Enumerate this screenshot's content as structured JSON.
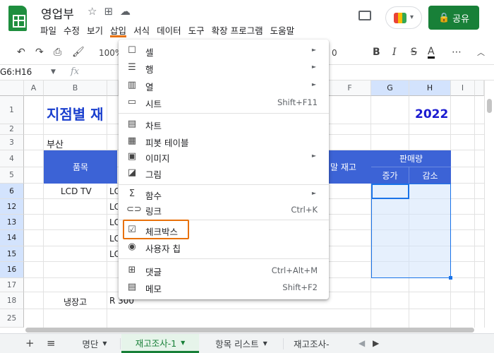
{
  "app": {
    "doc_title": "영업부",
    "share_label": "공유",
    "menus": [
      "파일",
      "수정",
      "보기",
      "삽입",
      "서식",
      "데이터",
      "도구",
      "확장 프로그램",
      "도움말"
    ],
    "active_menu": "삽입",
    "accent_color": "#188038",
    "highlight_color": "#e8710a"
  },
  "toolbar": {
    "zoom": "100%",
    "font_size_partial": "0",
    "bold": "B",
    "italic": "I",
    "strike": "S",
    "text_color": "A",
    "more": "⋯"
  },
  "formula_bar": {
    "name_box": "G6:H16",
    "fx": "fx"
  },
  "grid": {
    "columns": [
      "A",
      "B",
      "F",
      "G",
      "H",
      "I"
    ],
    "rows": [
      "1",
      "2",
      "3",
      "4",
      "5",
      "6",
      "12",
      "13",
      "14",
      "15",
      "16",
      "17",
      "18",
      "25"
    ],
    "title": "지점별 재",
    "year": "2022",
    "region": "부산",
    "header_item": "품목",
    "header_stock": "말 재고",
    "header_sales": "판매량",
    "header_increase": "증가",
    "header_decrease": "감소",
    "b6": "LCD TV",
    "b18": "냉장고",
    "c_partial": [
      "LC",
      "LC",
      "LC",
      "LC",
      "LC"
    ],
    "c18": "R 300"
  },
  "insert_menu": {
    "items": [
      {
        "icon": "cell-icon",
        "label": "셀",
        "shortcut": "",
        "submenu": true
      },
      {
        "icon": "row-icon",
        "label": "행",
        "shortcut": "",
        "submenu": true
      },
      {
        "icon": "column-icon",
        "label": "열",
        "shortcut": "",
        "submenu": true
      },
      {
        "icon": "sheet-icon",
        "label": "시트",
        "shortcut": "Shift+F11",
        "submenu": false
      },
      {
        "icon": "chart-icon",
        "label": "차트",
        "shortcut": "",
        "submenu": false
      },
      {
        "icon": "pivot-table-icon",
        "label": "피봇 테이블",
        "shortcut": "",
        "submenu": false
      },
      {
        "icon": "image-icon",
        "label": "이미지",
        "shortcut": "",
        "submenu": true
      },
      {
        "icon": "drawing-icon",
        "label": "그림",
        "shortcut": "",
        "submenu": false
      },
      {
        "icon": "function-icon",
        "label": "함수",
        "shortcut": "",
        "submenu": true
      },
      {
        "icon": "link-icon",
        "label": "링크",
        "shortcut": "Ctrl+K",
        "submenu": false
      },
      {
        "icon": "checkbox-icon",
        "label": "체크박스",
        "shortcut": "",
        "submenu": false
      },
      {
        "icon": "people-chip-icon",
        "label": "사용자 칩",
        "shortcut": "",
        "submenu": false
      },
      {
        "icon": "comment-icon",
        "label": "댓글",
        "shortcut": "Ctrl+Alt+M",
        "submenu": false
      },
      {
        "icon": "note-icon",
        "label": "메모",
        "shortcut": "Shift+F2",
        "submenu": false
      }
    ]
  },
  "sheet_tabs": {
    "tabs": [
      "명단",
      "재고조사-1",
      "항목 리스트",
      "재고조사-"
    ],
    "active": "재고조사-1"
  }
}
